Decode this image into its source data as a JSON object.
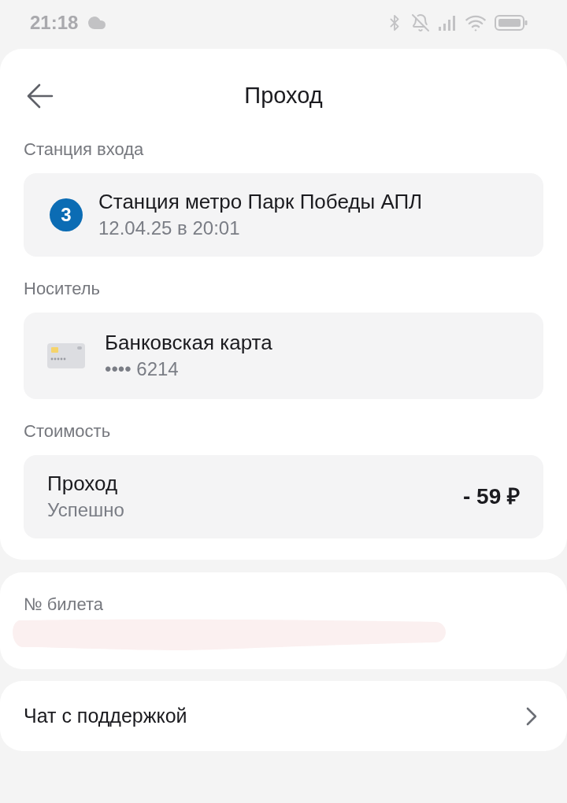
{
  "status_bar": {
    "time": "21:18"
  },
  "header": {
    "title": "Проход"
  },
  "sections": [
    {
      "label": "Станция входа",
      "kind": "station",
      "badge": {
        "text": "3",
        "color": "#0b6cb4"
      },
      "title": "Станция метро Парк Победы АПЛ",
      "subtitle": "12.04.25 в 20:01"
    },
    {
      "label": "Носитель",
      "kind": "card",
      "title": "Банковская карта",
      "subtitle": "•••• 6214"
    },
    {
      "label": "Стоимость",
      "kind": "payment",
      "title": "Проход",
      "subtitle": "Успешно",
      "amount": "- 59 ₽"
    }
  ],
  "ticket": {
    "label": "№ билета",
    "redacted": true
  },
  "support": {
    "label": "Чат с поддержкой"
  }
}
